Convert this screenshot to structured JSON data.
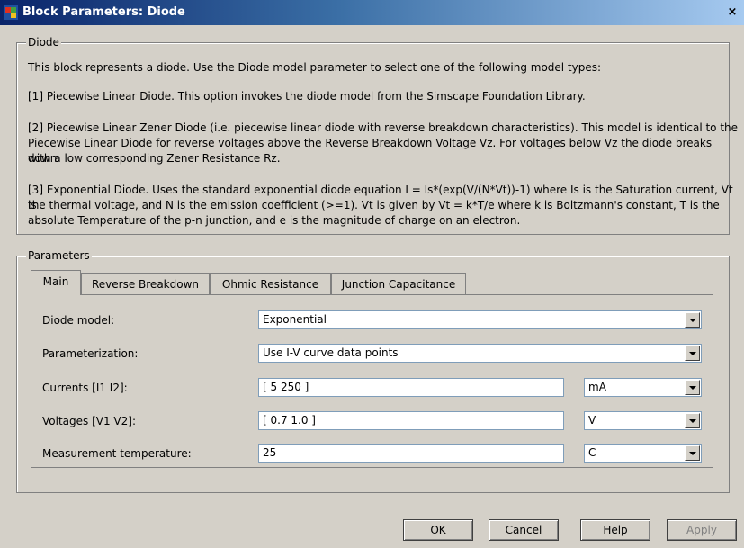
{
  "window": {
    "title": "Block Parameters: Diode",
    "close_glyph": "×"
  },
  "diode_group": {
    "legend": "Diode",
    "description": [
      "This block represents a diode. Use the Diode model parameter to select one of the following model types:",
      "[1] Piecewise Linear Diode. This option invokes the diode model from the Simscape Foundation Library.",
      "[2] Piecewise Linear Zener Diode (i.e. piecewise linear diode with reverse breakdown characteristics). This model is identical to the",
      "Piecewise Linear Diode for reverse voltages above the Reverse Breakdown Voltage Vz. For voltages below Vz the diode breaks down",
      "with a low corresponding Zener Resistance Rz.",
      "[3] Exponential Diode. Uses the standard exponential diode equation I = Is*(exp(V/(N*Vt))-1) where Is is the Saturation current, Vt is",
      "the thermal voltage, and N is the emission coefficient (>=1). Vt is given by Vt = k*T/e where k is Boltzmann's constant, T is the",
      "absolute Temperature of the p-n junction, and e is the magnitude of charge on an electron."
    ]
  },
  "parameters_group": {
    "legend": "Parameters",
    "tabs": [
      {
        "label": "Main"
      },
      {
        "label": "Reverse Breakdown"
      },
      {
        "label": "Ohmic Resistance"
      },
      {
        "label": "Junction Capacitance"
      }
    ],
    "fields": {
      "diode_model": {
        "label": "Diode model:",
        "value": "Exponential"
      },
      "parameterization": {
        "label": "Parameterization:",
        "value": "Use I-V curve data points"
      },
      "currents": {
        "label": "Currents [I1 I2]:",
        "value": "[ 5 250 ]",
        "unit": "mA"
      },
      "voltages": {
        "label": "Voltages [V1 V2]:",
        "value": "[ 0.7 1.0 ]",
        "unit": "V"
      },
      "temperature": {
        "label": "Measurement temperature:",
        "value": "25",
        "unit": "C"
      }
    }
  },
  "buttons": {
    "ok": "OK",
    "cancel": "Cancel",
    "help": "Help",
    "apply": "Apply"
  }
}
